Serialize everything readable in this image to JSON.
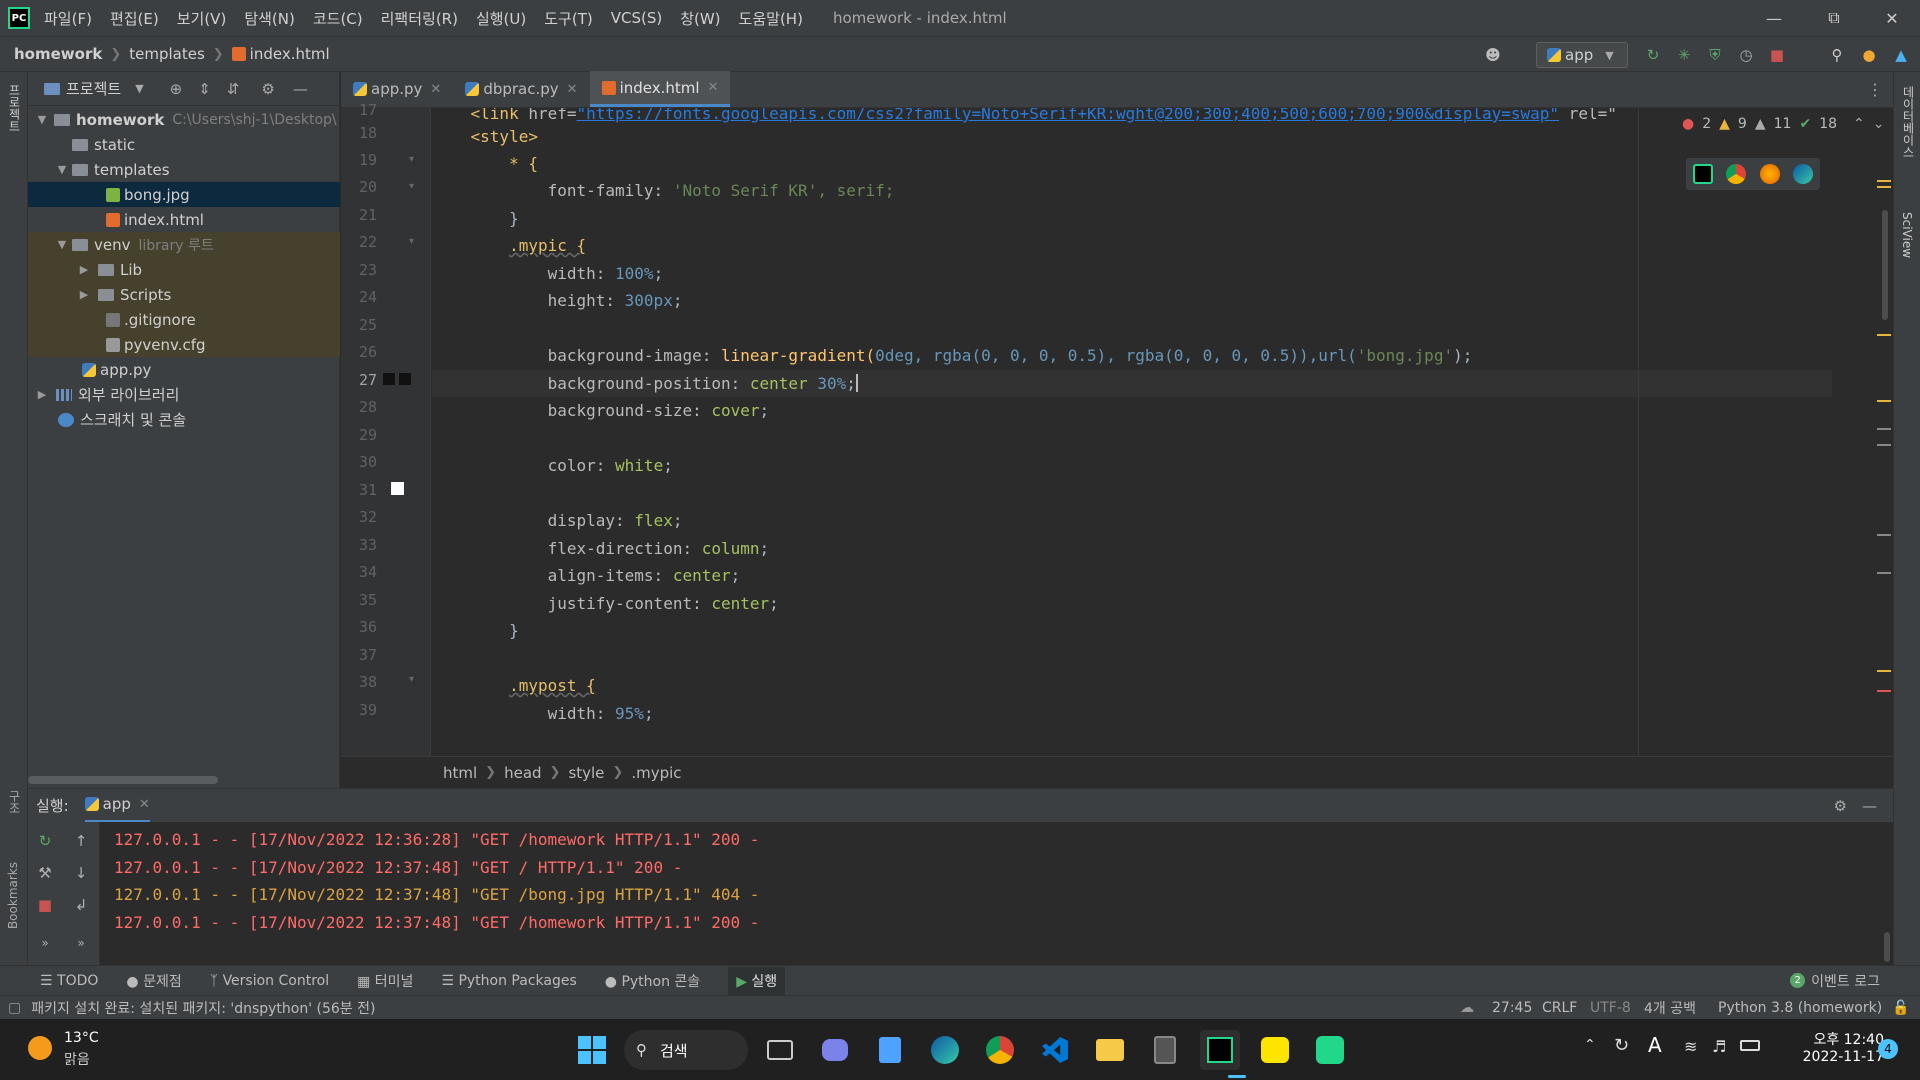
{
  "titlebar": {
    "menu": [
      "파일(F)",
      "편집(E)",
      "보기(V)",
      "탐색(N)",
      "코드(C)",
      "리팩터링(R)",
      "실행(U)",
      "도구(T)",
      "VCS(S)",
      "창(W)",
      "도움말(H)"
    ],
    "window_title": "homework - index.html",
    "logo": "PC"
  },
  "navbar": {
    "crumbs": [
      "homework",
      "templates",
      "index.html"
    ],
    "run_config": "app"
  },
  "project": {
    "header": "프로젝트",
    "tree": [
      {
        "label": "homework",
        "extra": "C:\\Users\\shj-1\\Desktop\\"
      },
      {
        "label": "static"
      },
      {
        "label": "templates"
      },
      {
        "label": "bong.jpg"
      },
      {
        "label": "index.html"
      },
      {
        "label": "venv",
        "extra": "library 루트"
      },
      {
        "label": "Lib"
      },
      {
        "label": "Scripts"
      },
      {
        "label": ".gitignore"
      },
      {
        "label": "pyvenv.cfg"
      },
      {
        "label": "app.py"
      },
      {
        "label": "외부 라이브러리"
      },
      {
        "label": "스크래치 및 콘솔"
      }
    ]
  },
  "left_stripe": {
    "project": "프로젝트",
    "structure": "구조",
    "bookmarks": "Bookmarks"
  },
  "right_stripe": {
    "database": "데이터베이스",
    "sciview": "SciView"
  },
  "tabs": [
    {
      "label": "app.py"
    },
    {
      "label": "dbprac.py"
    },
    {
      "label": "index.html"
    }
  ],
  "inspections": {
    "errors": "2",
    "warnings": "9",
    "weak": "11",
    "ok": "18"
  },
  "editor": {
    "lines": [
      "17",
      "18",
      "19",
      "20",
      "21",
      "22",
      "23",
      "24",
      "25",
      "26",
      "27",
      "28",
      "29",
      "30",
      "31",
      "32",
      "33",
      "34",
      "35",
      "36",
      "37",
      "38",
      "39"
    ],
    "code": {
      "l17": {
        "tag": "<link",
        "attr": " href=",
        "url": "\"https://fonts.googleapis.com/css2?family=Noto+Serif+KR:wght@200;300;400;500;600;700;900&display=swap\"",
        "rest": " rel=\""
      },
      "l18": "<style>",
      "l19": "* {",
      "l20_prop": "font-family: ",
      "l20_val": "'Noto Serif KR', serif;",
      "l21": "}",
      "l22": ".mypic {",
      "l23_prop": "width: ",
      "l23_val": "100%",
      "l24_prop": "height: ",
      "l24_val": "300px",
      "l26_prop": "background-image: ",
      "l26_fn": "linear-gradient(",
      "l26_args": "0deg, rgba(0, 0, 0, 0.5), rgba(0, 0, 0, 0.5)),url(",
      "l26_str": "'bong.jpg'",
      "l26_end": ");",
      "l27_prop": "background-position: ",
      "l27_val": "center ",
      "l27_num": "30%",
      "l28_prop": "background-size: ",
      "l28_val": "cover",
      "l30_prop": "color: ",
      "l30_val": "white",
      "l32_prop": "display: ",
      "l32_val": "flex",
      "l33_prop": "flex-direction: ",
      "l33_val": "column",
      "l34_prop": "align-items: ",
      "l34_val": "center",
      "l35_prop": "justify-content: ",
      "l35_val": "center",
      "l36": "}",
      "l38": ".mypost {",
      "l39_prop": "width: ",
      "l39_val": "95%"
    }
  },
  "breadcrumb": [
    "html",
    "head",
    "style",
    ".mypic"
  ],
  "run": {
    "label": "실행:",
    "tab": "app",
    "logs": [
      {
        "text": "127.0.0.1 - - [17/Nov/2022 12:36:28] \"GET /homework HTTP/1.1\" 200 -",
        "level": "error"
      },
      {
        "text": "127.0.0.1 - - [17/Nov/2022 12:37:48] \"GET / HTTP/1.1\" 200 -",
        "level": "error"
      },
      {
        "text": "127.0.0.1 - - [17/Nov/2022 12:37:48] \"GET /bong.jpg HTTP/1.1\" 404 -",
        "level": "warn"
      },
      {
        "text": "127.0.0.1 - - [17/Nov/2022 12:37:48] \"GET /homework HTTP/1.1\" 200 -",
        "level": "error"
      }
    ]
  },
  "tool_tabs": [
    "TODO",
    "문제점",
    "Version Control",
    "터미널",
    "Python Packages",
    "Python 콘솔",
    "실행"
  ],
  "event_log": {
    "count": "2",
    "label": "이벤트 로그"
  },
  "statusbar": {
    "message": "패키지 설치 완료: 설치된 패키지: 'dnspython' (56분 전)",
    "position": "27:45",
    "line_sep": "CRLF",
    "encoding": "UTF-8",
    "indent": "4개 공백",
    "interpreter": "Python 3.8 (homework)"
  },
  "taskbar": {
    "weather_temp": "13°C",
    "weather_desc": "맑음",
    "search": "검색",
    "ime": "A",
    "time": "오후 12:40",
    "date": "2022-11-17",
    "notifications": "4"
  }
}
